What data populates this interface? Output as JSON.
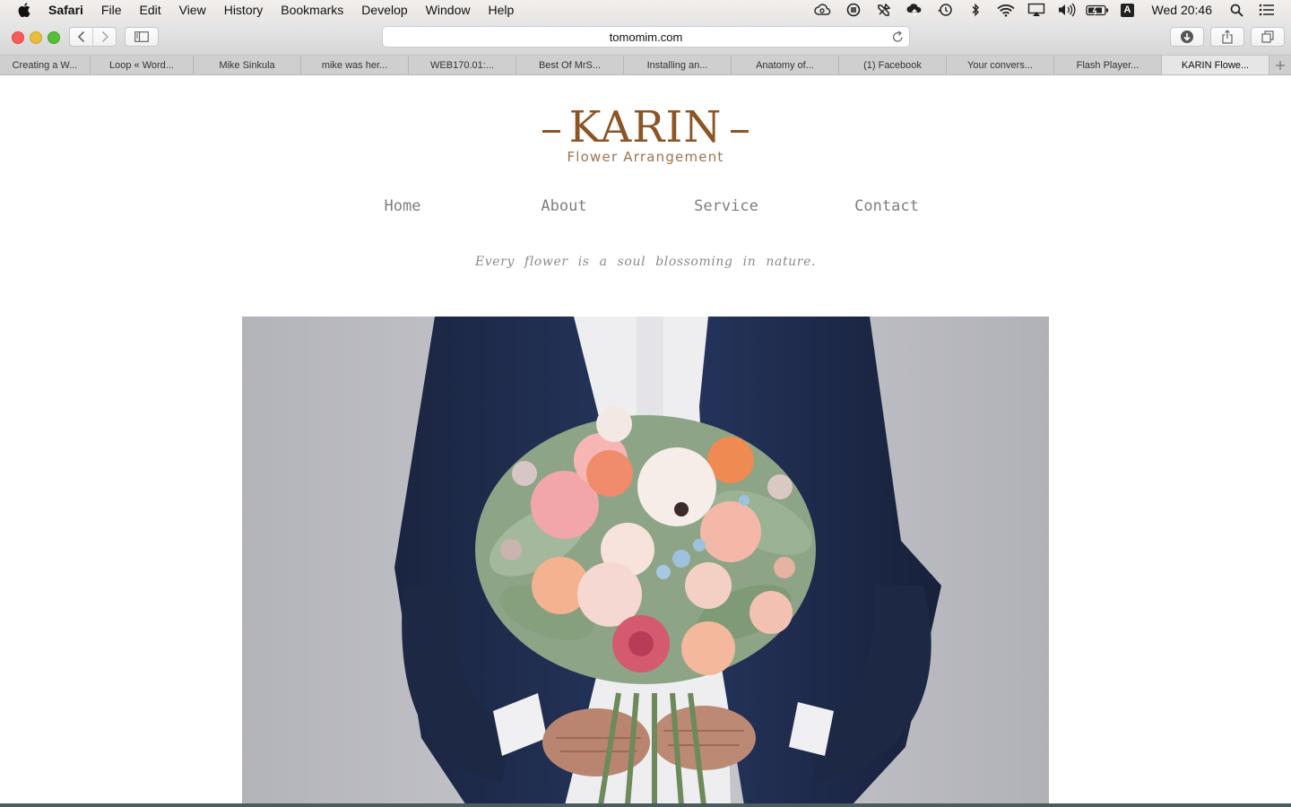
{
  "menubar": {
    "app_name": "Safari",
    "menus": [
      "File",
      "Edit",
      "View",
      "History",
      "Bookmarks",
      "Develop",
      "Window",
      "Help"
    ],
    "input_source": "A",
    "clock": "Wed 20:46"
  },
  "toolbar": {
    "url": "tomomim.com"
  },
  "tabs": [
    {
      "label": "Creating a W..."
    },
    {
      "label": "Loop « Word..."
    },
    {
      "label": "Mike Sinkula"
    },
    {
      "label": "mike was her..."
    },
    {
      "label": "WEB170.01:..."
    },
    {
      "label": "Best Of MrS..."
    },
    {
      "label": "Installing an..."
    },
    {
      "label": "Anatomy of..."
    },
    {
      "label": "(1) Facebook"
    },
    {
      "label": "Your convers..."
    },
    {
      "label": "Flash Player..."
    },
    {
      "label": "KARIN Flowe..."
    }
  ],
  "site": {
    "logo_title": "KARIN",
    "logo_subtitle": "Flower Arrangement",
    "nav": [
      "Home",
      "About",
      "Service",
      "Contact"
    ],
    "tagline": "Every flower is a soul blossoming in nature."
  },
  "colors": {
    "brand": "#8c5525",
    "nav_text": "#7e7e7e",
    "suit": "#1f2c48"
  }
}
